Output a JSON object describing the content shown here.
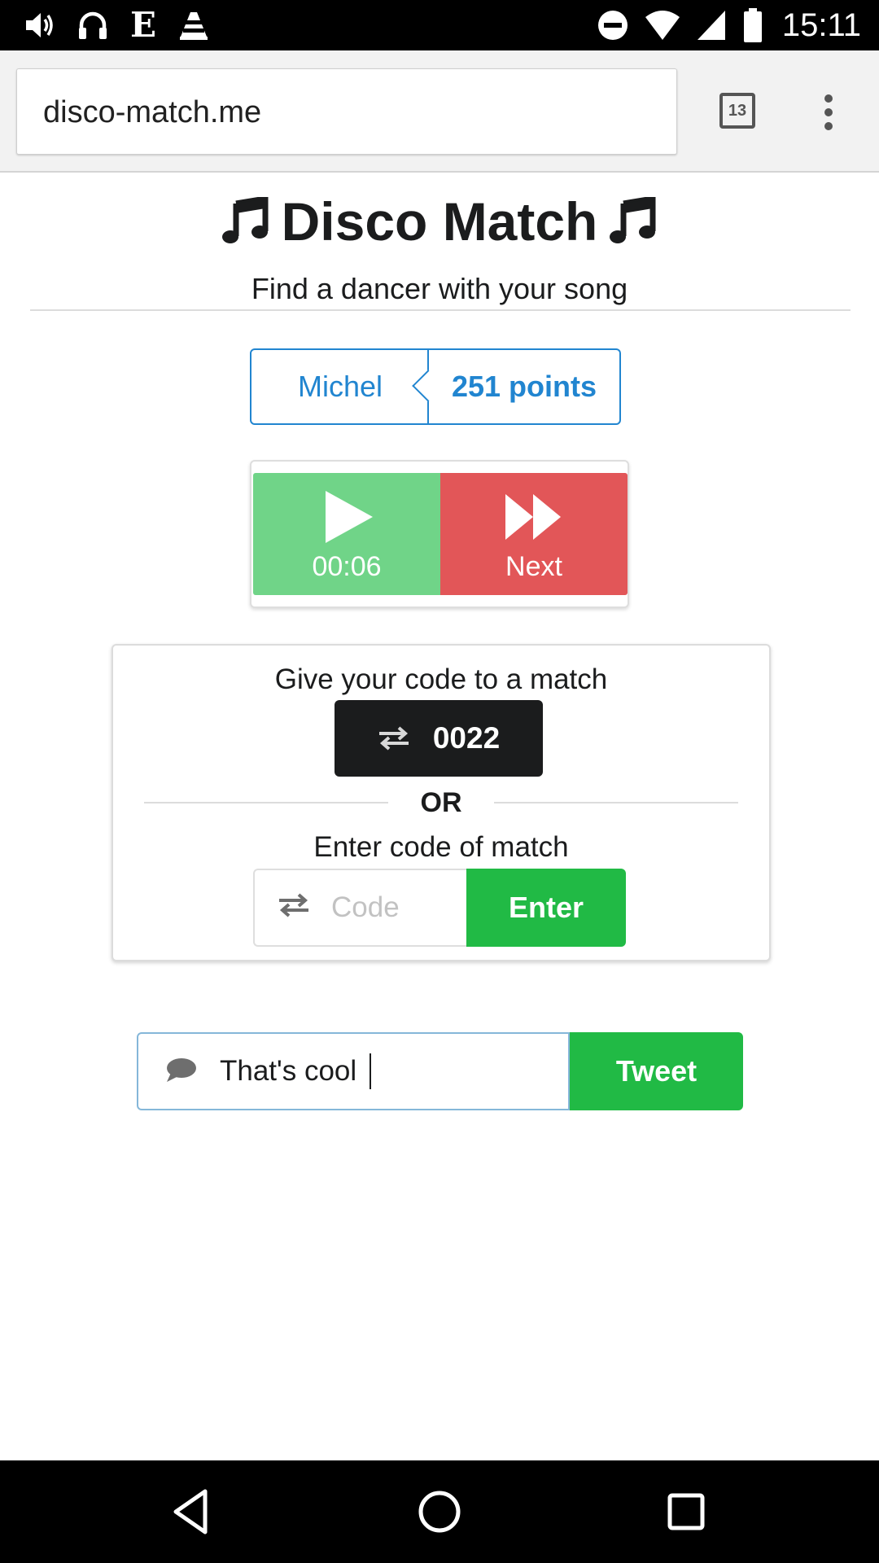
{
  "status_bar": {
    "time": "15:11",
    "left_icons": [
      "volume-icon",
      "headphones-icon",
      "e-app-icon",
      "vlc-icon"
    ],
    "right_icons": [
      "do-not-disturb-icon",
      "wifi-icon",
      "signal-icon",
      "battery-icon"
    ],
    "e_glyph": "E"
  },
  "browser": {
    "url": "disco-match.me",
    "tab_count": "13",
    "menu_icon": "overflow-menu-icon"
  },
  "page": {
    "title": "Disco Match",
    "title_icon": "music-note-icon",
    "subtitle": "Find a dancer with your song"
  },
  "user": {
    "name": "Michel",
    "points": "251 points"
  },
  "player": {
    "play_time": "00:06",
    "next_label": "Next",
    "play_icon": "play-icon",
    "next_icon": "fast-forward-icon"
  },
  "code_section": {
    "give_heading": "Give your code to a match",
    "my_code": "0022",
    "or_label": "OR",
    "enter_heading": "Enter code of match",
    "code_placeholder": "Code",
    "enter_button": "Enter",
    "exchange_icon": "exchange-icon"
  },
  "tweet": {
    "value": "That's cool",
    "button": "Tweet",
    "comment_icon": "comment-icon"
  },
  "nav": {
    "back_icon": "back-icon",
    "home_icon": "home-icon",
    "recents_icon": "recents-icon"
  },
  "colors": {
    "primary_blue": "#2185d0",
    "play_green": "#70d488",
    "next_red": "#e25658",
    "action_green": "#21ba45",
    "badge_black": "#1b1c1d"
  }
}
